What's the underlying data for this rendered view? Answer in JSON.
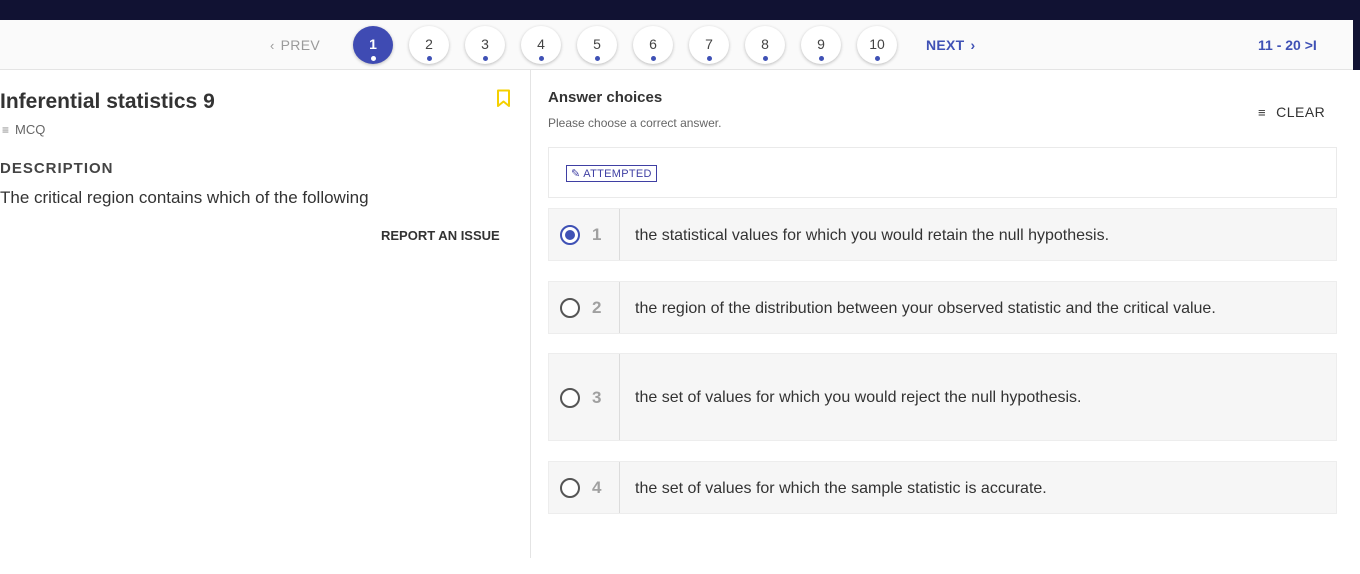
{
  "pager": {
    "prev_label": "PREV",
    "prev_icon": "chevron-left-icon",
    "pages": [
      "1",
      "2",
      "3",
      "4",
      "5",
      "6",
      "7",
      "8",
      "9",
      "10"
    ],
    "active_page": "1",
    "next_label": "NEXT",
    "next_icon": "chevron-right-icon",
    "range_label": "11 - 20 >I",
    "accent_color": "#3f4bb3"
  },
  "question": {
    "title": "Inferential statistics 9",
    "type": "MCQ",
    "bookmark_icon": "bookmark-icon",
    "bookmark_color": "#f5d000",
    "description_heading": "DESCRIPTION",
    "description": "The critical region contains which of the following",
    "report_label": "REPORT AN ISSUE"
  },
  "answers": {
    "heading": "Answer choices",
    "subheading": "Please choose a correct answer.",
    "clear_label": "CLEAR",
    "status_badge": "ATTEMPTED",
    "choices": [
      {
        "num": "1",
        "text": "the statistical values for which you would retain the null hypothesis.",
        "selected": true
      },
      {
        "num": "2",
        "text": "the region of the distribution between your observed statistic and the critical value.",
        "selected": false
      },
      {
        "num": "3",
        "text": "the set of values for which you would reject the null hypothesis.",
        "selected": false
      },
      {
        "num": "4",
        "text": "the set of values for which the sample statistic is accurate.",
        "selected": false
      }
    ]
  }
}
